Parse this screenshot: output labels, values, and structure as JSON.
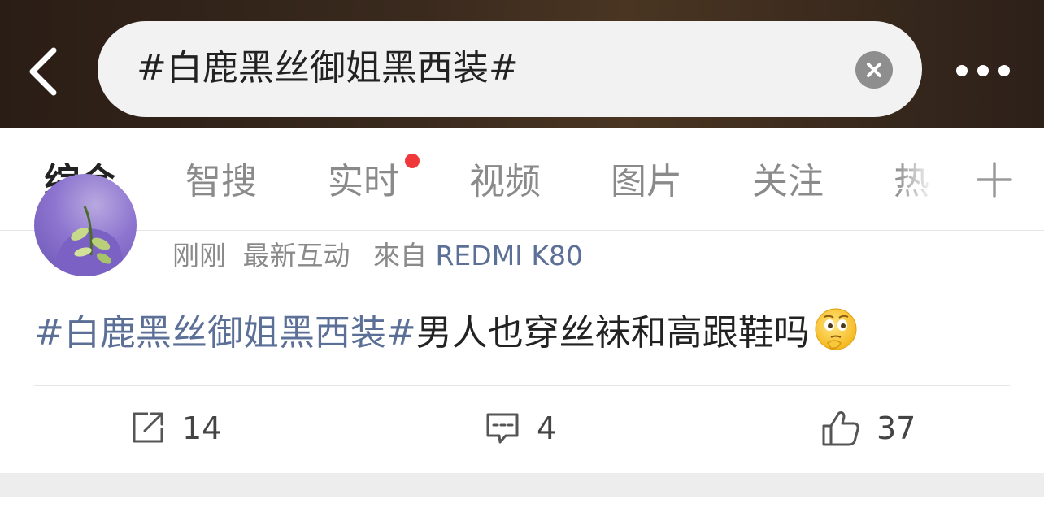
{
  "search": {
    "query": "#白鹿黑丝御姐黑西装#"
  },
  "icons": {
    "back": "chevron-left-icon",
    "clear": "clear-circle-icon",
    "more": "more-dots-icon",
    "add_tab": "plus-icon",
    "repost": "repost-icon",
    "comment": "comment-icon",
    "like": "thumbs-up-icon",
    "emoji": "thinking-face-emoji"
  },
  "tabs": [
    {
      "label": "综合"
    },
    {
      "label": "智搜"
    },
    {
      "label": "实时"
    },
    {
      "label": "视频"
    },
    {
      "label": "图片"
    },
    {
      "label": "关注"
    },
    {
      "label": "热"
    }
  ],
  "post": {
    "time": "刚刚",
    "activity": "最新互动",
    "source_prefix": "來自",
    "device": "REDMI K80",
    "hashtag": "#白鹿黑丝御姐黑西装#",
    "text": "男人也穿丝袜和高跟鞋吗",
    "actions": {
      "reposts": "14",
      "comments": "4",
      "likes": "37"
    }
  },
  "colors": {
    "accent": "#ff8200",
    "link": "#5b6f97",
    "notification_dot": "#f0383a"
  }
}
